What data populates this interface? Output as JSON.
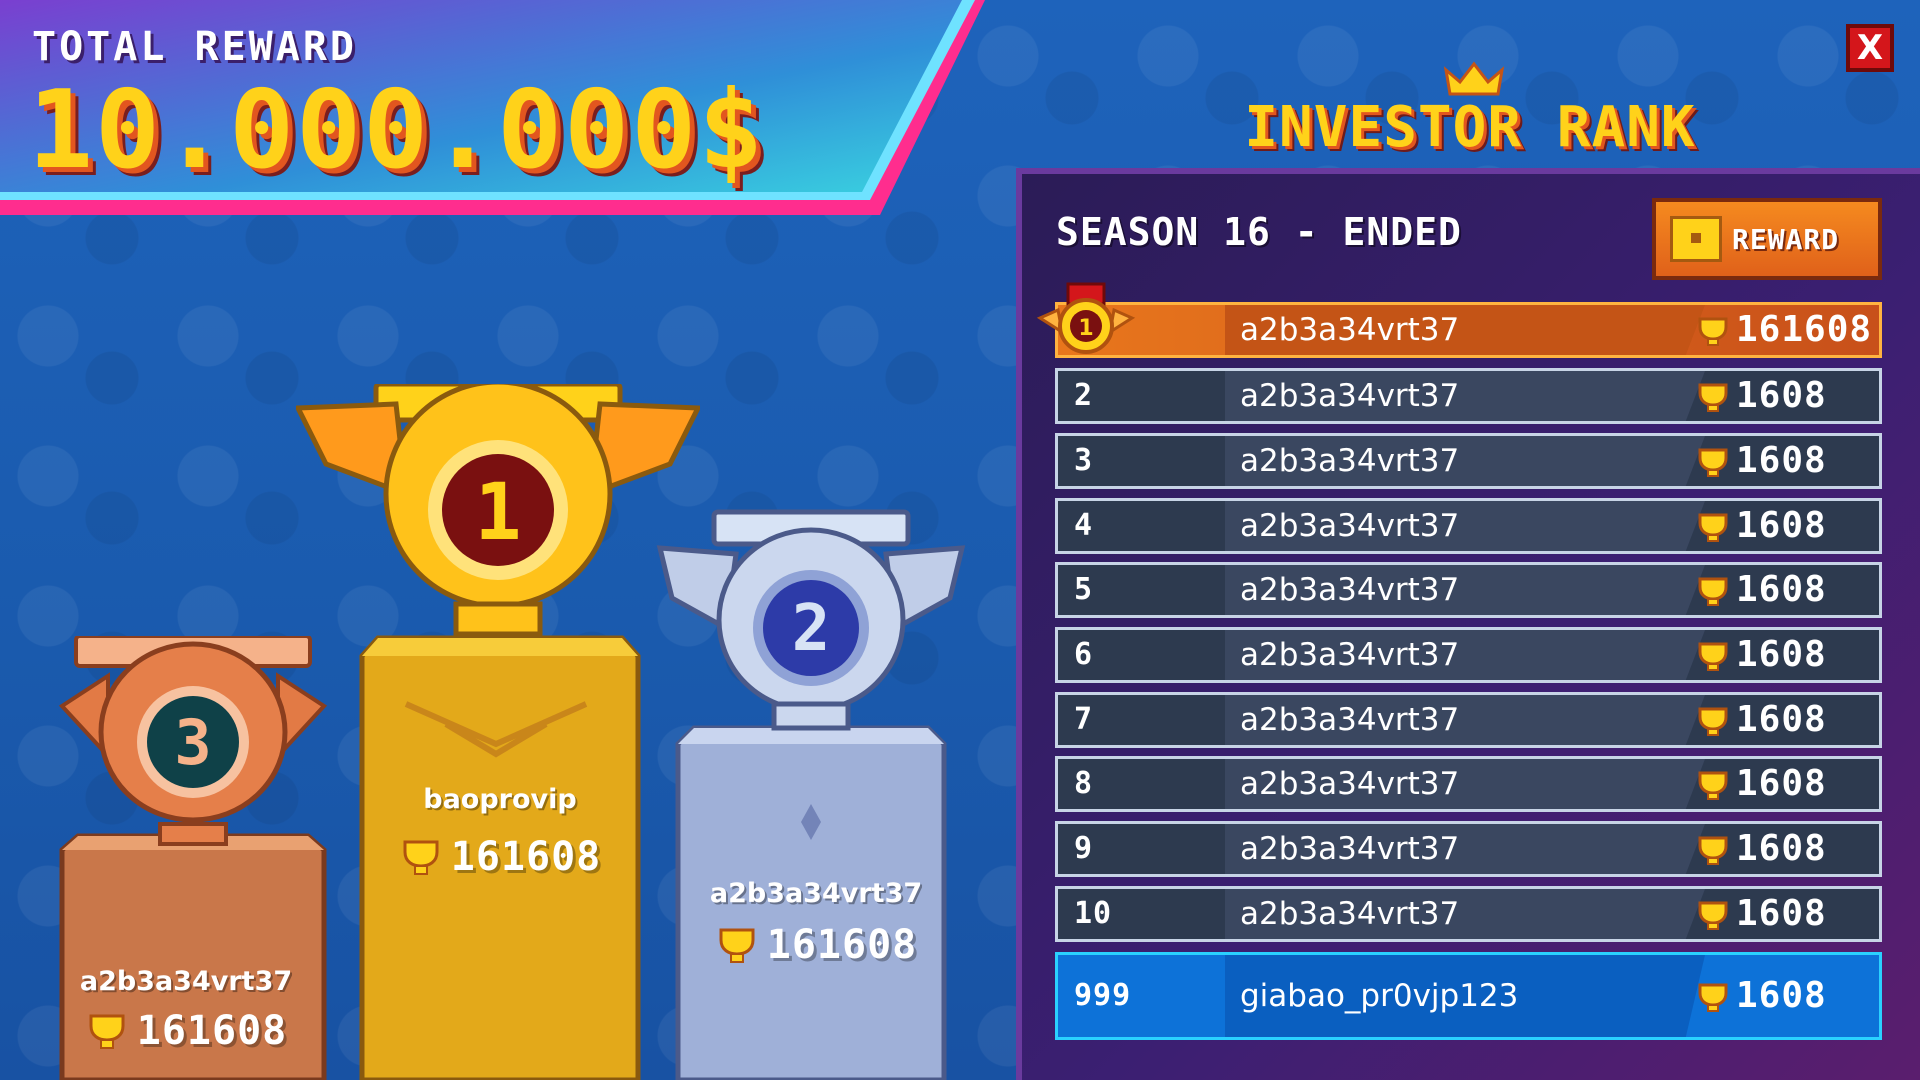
{
  "banner": {
    "label": "TOTAL REWARD",
    "amount": "10.000.000$"
  },
  "close": {
    "label": "X"
  },
  "title": "INVESTOR RANK",
  "season": "SEASON 16 - ENDED",
  "reward_button": "REWARD",
  "podium": [
    {
      "place": "1",
      "name": "baoprovip",
      "score": "161608"
    },
    {
      "place": "2",
      "name": "a2b3a34vrt37",
      "score": "161608"
    },
    {
      "place": "3",
      "name": "a2b3a34vrt37",
      "score": "161608"
    }
  ],
  "leaderboard": [
    {
      "rank": "1",
      "name": "a2b3a34vrt37",
      "score": "161608"
    },
    {
      "rank": "2",
      "name": "a2b3a34vrt37",
      "score": "1608"
    },
    {
      "rank": "3",
      "name": "a2b3a34vrt37",
      "score": "1608"
    },
    {
      "rank": "4",
      "name": "a2b3a34vrt37",
      "score": "1608"
    },
    {
      "rank": "5",
      "name": "a2b3a34vrt37",
      "score": "1608"
    },
    {
      "rank": "6",
      "name": "a2b3a34vrt37",
      "score": "1608"
    },
    {
      "rank": "7",
      "name": "a2b3a34vrt37",
      "score": "1608"
    },
    {
      "rank": "8",
      "name": "a2b3a34vrt37",
      "score": "1608"
    },
    {
      "rank": "9",
      "name": "a2b3a34vrt37",
      "score": "1608"
    },
    {
      "rank": "10",
      "name": "a2b3a34vrt37",
      "score": "1608"
    }
  ],
  "my_rank": {
    "rank": "999",
    "name": "giabao_pr0vjp123",
    "score": "1608"
  },
  "colors": {
    "gold": "#ffd21a",
    "orange": "#e8761c",
    "panel": "#3b1f72",
    "me": "#0d72d8"
  }
}
